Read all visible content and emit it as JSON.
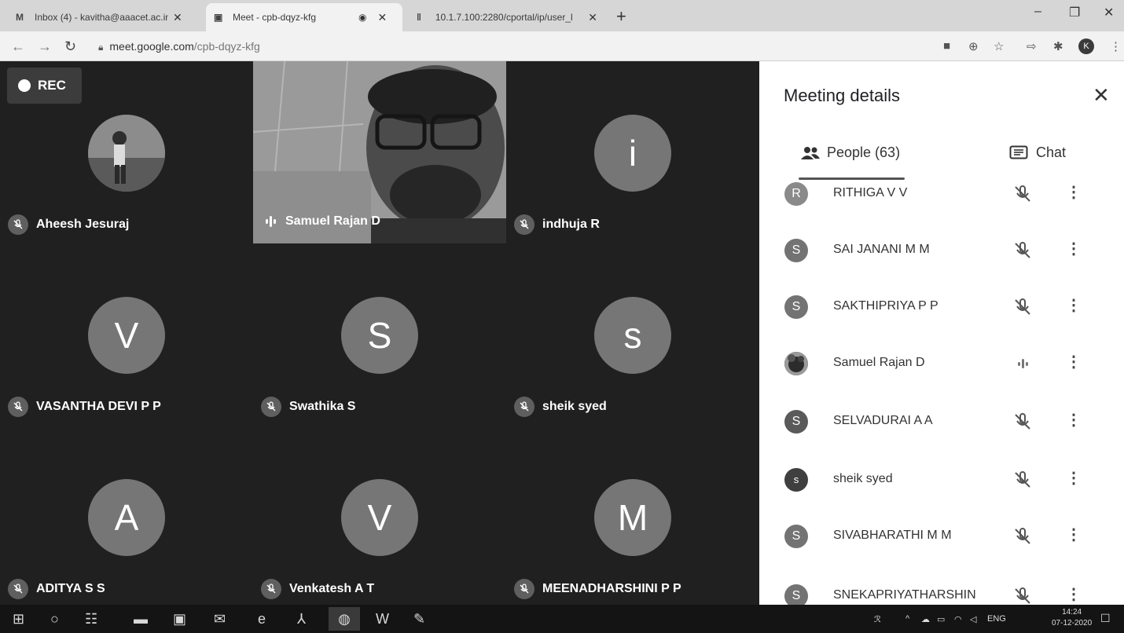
{
  "browser": {
    "tabs": [
      {
        "icon": "gmail-icon",
        "label": "Inbox (4) - kavitha@aaacet.ac.in",
        "active": false
      },
      {
        "icon": "meet-icon",
        "label": "Meet - cpb-dqyz-kfg",
        "active": true
      },
      {
        "icon": "portal-icon",
        "label": "10.1.7.100:2280/cportal/ip/user_l",
        "active": false
      }
    ],
    "new_tab": "+",
    "url_host": "meet.google.com",
    "url_path": "/cpb-dqyz-kfg",
    "profile_initial": "K"
  },
  "meeting": {
    "rec_label": "REC",
    "tiles": [
      {
        "name": "Aheesh Jesuraj",
        "avatar": "",
        "type": "photo",
        "muted": true
      },
      {
        "name": "Samuel Rajan D",
        "avatar": "",
        "type": "video",
        "muted": false
      },
      {
        "name": "indhuja R",
        "avatar": "i",
        "type": "letter",
        "muted": true
      },
      {
        "name": "VASANTHA DEVI P P",
        "avatar": "V",
        "type": "letter",
        "muted": true
      },
      {
        "name": "Swathika S",
        "avatar": "S",
        "type": "letter",
        "muted": true
      },
      {
        "name": "sheik syed",
        "avatar": "s",
        "type": "letter",
        "muted": true
      },
      {
        "name": "ADITYA S S",
        "avatar": "A",
        "type": "letter",
        "muted": true
      },
      {
        "name": "Venkatesh A T",
        "avatar": "V",
        "type": "letter",
        "muted": true
      },
      {
        "name": "MEENADHARSHINI P P",
        "avatar": "M",
        "type": "letter",
        "muted": true
      }
    ]
  },
  "panel": {
    "title": "Meeting details",
    "close": "✕",
    "tab_people": "People (63)",
    "tab_chat": "Chat",
    "people": [
      {
        "initial": "R",
        "name": "RITHIGA V V",
        "muted": true
      },
      {
        "initial": "S",
        "name": "SAI JANANI M M",
        "muted": true
      },
      {
        "initial": "S",
        "name": "SAKTHIPRIYA P P",
        "muted": true
      },
      {
        "initial": "",
        "name": "Samuel Rajan D",
        "muted": false,
        "photo": true
      },
      {
        "initial": "S",
        "name": "SELVADURAI A A",
        "muted": true
      },
      {
        "initial": "s",
        "name": "sheik syed",
        "muted": true
      },
      {
        "initial": "S",
        "name": "SIVABHARATHI M M",
        "muted": true
      },
      {
        "initial": "S",
        "name": "SNEKAPRIYATHARSHIN",
        "muted": true
      }
    ]
  },
  "taskbar": {
    "lang": "ENG",
    "time": "14:24",
    "date": "07-12-2020"
  }
}
